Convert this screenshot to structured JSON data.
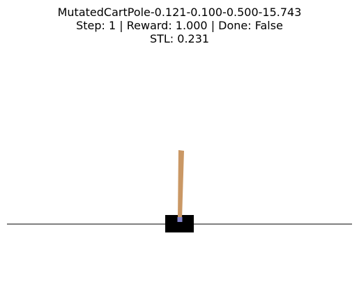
{
  "env": {
    "name": "MutatedCartPole-0.121-0.100-0.500-15.743",
    "status_line": "Step: 1 | Reward: 1.000 | Done: False",
    "stl_line": "STL: 0.231"
  },
  "colors": {
    "background": "#ffffff",
    "track": "#000000",
    "cart": "#000000",
    "pole": "#ca9865",
    "axle": "#8283ca"
  }
}
